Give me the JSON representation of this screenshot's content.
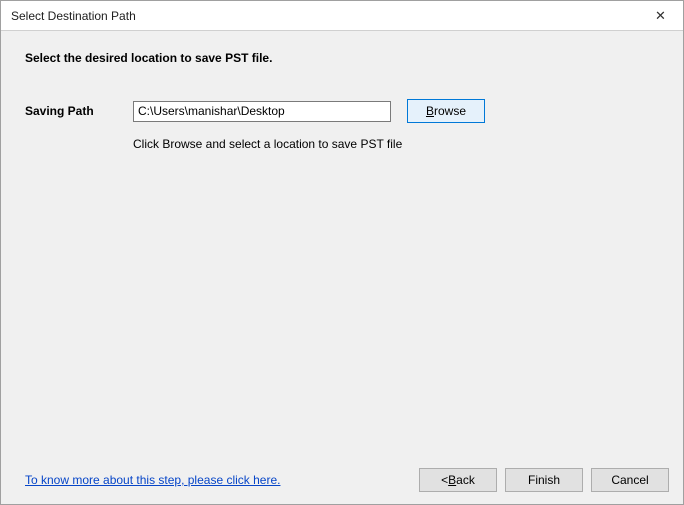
{
  "window": {
    "title": "Select Destination Path",
    "close_glyph": "✕"
  },
  "heading": "Select the desired location to save PST file.",
  "saving_path": {
    "label": "Saving Path",
    "value": "C:\\Users\\manishar\\Desktop",
    "browse_prefix": "B",
    "browse_rest": "rowse",
    "hint": "Click Browse and select a location to save PST file"
  },
  "footer": {
    "help_link": "To know more about this step, please click here.",
    "back_prefix": "< ",
    "back_u": "B",
    "back_rest": "ack",
    "finish": "Finish",
    "cancel": "Cancel"
  }
}
